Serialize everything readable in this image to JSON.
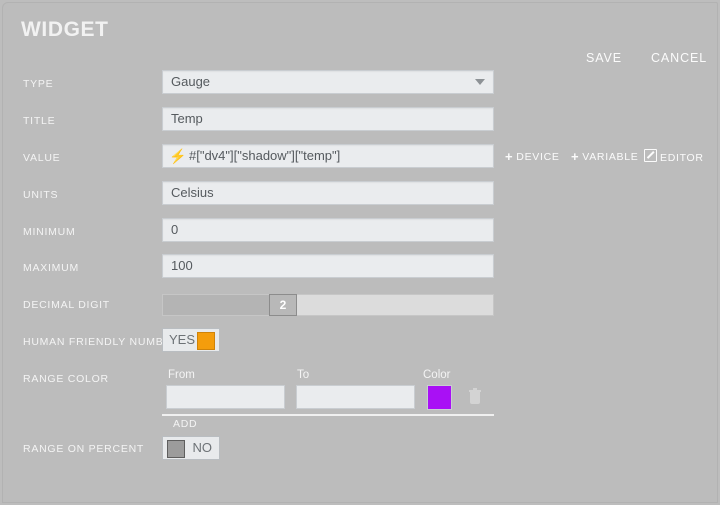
{
  "header": {
    "title": "WIDGET",
    "save_label": "SAVE",
    "cancel_label": "CANCEL"
  },
  "form": {
    "type": {
      "label": "TYPE",
      "value": "Gauge",
      "icon": "chevron-down-icon"
    },
    "title": {
      "label": "TITLE",
      "value": "Temp"
    },
    "value": {
      "label": "VALUE",
      "value": "#[\"dv4\"][\"shadow\"][\"temp\"]",
      "icon": "lightning-bolt-icon",
      "icon_color": "#1e7fe0",
      "actions": [
        {
          "label": "DEVICE",
          "icon": "plus-icon",
          "glyph": "+"
        },
        {
          "label": "VARIABLE",
          "icon": "plus-icon",
          "glyph": "+"
        },
        {
          "label": "EDITOR",
          "icon": "pencil-square-icon"
        }
      ]
    },
    "units": {
      "label": "UNITS",
      "value": "Celsius"
    },
    "minimum": {
      "label": "MINIMUM",
      "value": "0"
    },
    "maximum": {
      "label": "MAXIMUM",
      "value": "100"
    },
    "decimal_digit": {
      "label": "DECIMAL DIGIT",
      "value": "2"
    },
    "human_friendly_number": {
      "label": "HUMAN FRIENDLY NUMBER",
      "value": "YES",
      "swatch_color": "#f49d0c"
    },
    "range_color": {
      "label": "RANGE COLOR",
      "columns": {
        "from": "From",
        "to": "To",
        "color": "Color"
      },
      "rows": [
        {
          "from": "",
          "to": "",
          "color": "#a910f5"
        }
      ],
      "add_label": "ADD",
      "delete_icon": "trash-icon"
    },
    "range_on_percent": {
      "label": "RANGE ON PERCENT",
      "value": "NO",
      "swatch_color": "#9c9c9c"
    }
  }
}
